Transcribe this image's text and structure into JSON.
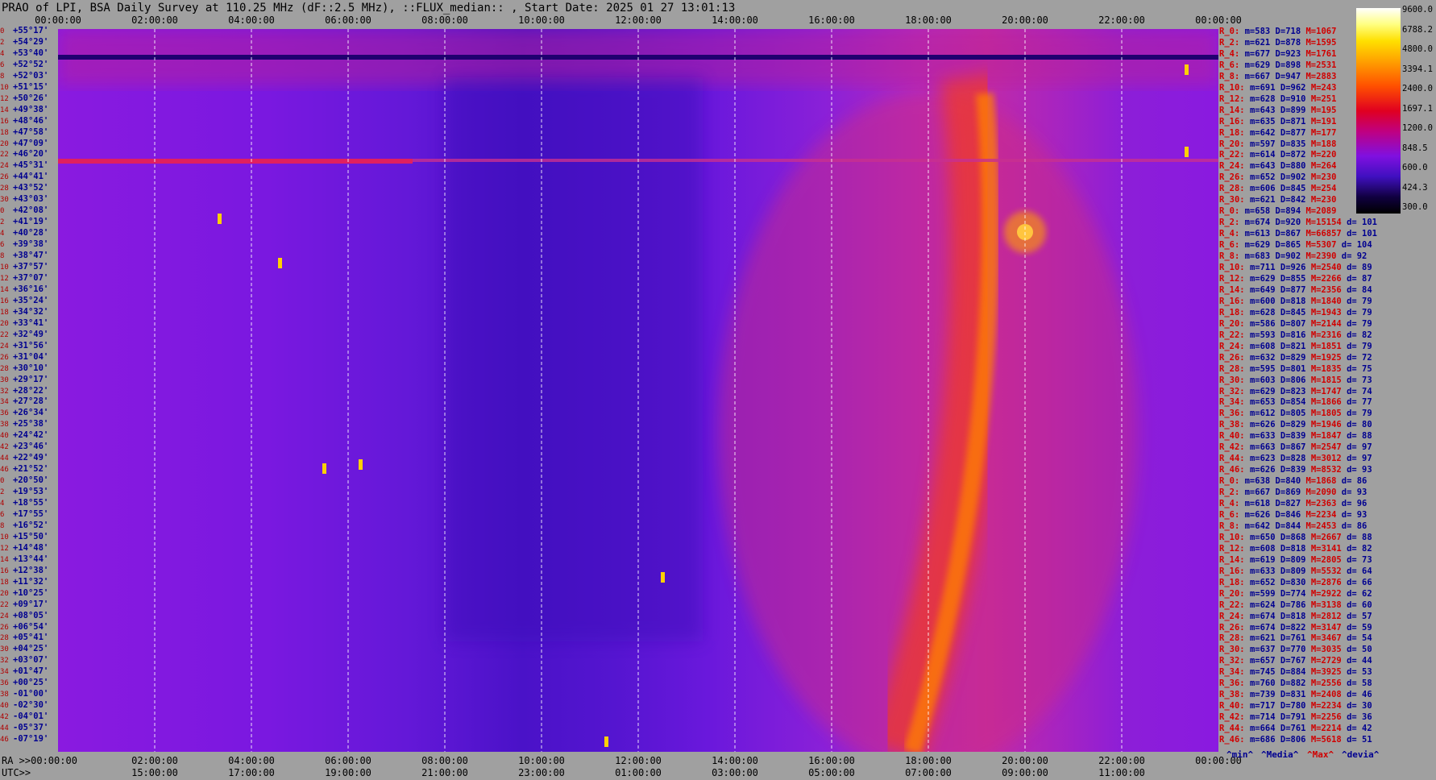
{
  "title": "PRAO of LPI, BSA Daily Survey at 110.25 MHz (dF::2.5 MHz), ::FLUX_median:: , Start Date: 2025 01 27 13:01:13",
  "chart_data": {
    "type": "heatmap",
    "title": "PRAO of LPI, BSA Daily Survey at 110.25 MHz (dF::2.5 MHz), ::FLUX_median:: , Start Date: 2025 01 27 13:01:13",
    "x_ra_ticks": [
      "00:00:00",
      "02:00:00",
      "04:00:00",
      "06:00:00",
      "08:00:00",
      "10:00:00",
      "12:00:00",
      "14:00:00",
      "16:00:00",
      "18:00:00",
      "20:00:00",
      "22:00:00",
      "00:00:00"
    ],
    "x_utc_ticks": [
      "15:00:00",
      "17:00:00",
      "19:00:00",
      "21:00:00",
      "23:00:00",
      "01:00:00",
      "03:00:00",
      "05:00:00",
      "07:00:00",
      "09:00:00",
      "11:00:00"
    ],
    "x_ra_prefix": "RA >>00:00:00",
    "x_utc_prefix": "UTC>>",
    "y_declinations": [
      "+55°17'",
      "+54°29'",
      "+53°40'",
      "+52°52'",
      "+52°03'",
      "+51°15'",
      "+50°26'",
      "+49°38'",
      "+48°46'",
      "+47°58'",
      "+47°09'",
      "+46°20'",
      "+45°31'",
      "+44°41'",
      "+43°52'",
      "+43°03'",
      "+42°08'",
      "+41°19'",
      "+40°28'",
      "+39°38'",
      "+38°47'",
      "+37°57'",
      "+37°07'",
      "+36°16'",
      "+35°24'",
      "+34°32'",
      "+33°41'",
      "+32°49'",
      "+31°56'",
      "+31°04'",
      "+30°10'",
      "+29°17'",
      "+28°22'",
      "+27°28'",
      "+26°34'",
      "+25°38'",
      "+24°42'",
      "+23°46'",
      "+22°49'",
      "+21°52'",
      "+20°50'",
      "+19°53'",
      "+18°55'",
      "+17°55'",
      "+16°52'",
      "+15°50'",
      "+14°48'",
      "+13°44'",
      "+12°38'",
      "+11°32'",
      "+10°25'",
      "+09°17'",
      "+08°05'",
      "+06°54'",
      "+05°41'",
      "+04°25'",
      "+03°07'",
      "+01°47'",
      "+00°25'",
      "-01°00'",
      "-02°30'",
      "-04°01'",
      "-05°37'",
      "-07°19'"
    ],
    "y_indices": [
      "0",
      "2",
      "4",
      "6",
      "8",
      "10",
      "12",
      "14",
      "16",
      "18",
      "20",
      "22",
      "24",
      "26",
      "28",
      "30",
      "0",
      "2",
      "4",
      "6",
      "8",
      "10",
      "12",
      "14",
      "16",
      "18",
      "20",
      "22",
      "24",
      "26",
      "28",
      "30",
      "32",
      "34",
      "36",
      "38",
      "40",
      "42",
      "44",
      "46",
      "0",
      "2",
      "4",
      "6",
      "8",
      "10",
      "12",
      "14",
      "16",
      "18",
      "20",
      "22",
      "24",
      "26",
      "28",
      "30",
      "32",
      "34",
      "36",
      "38",
      "40",
      "42",
      "44",
      "46"
    ],
    "colorbar_ticks": [
      "9600.0",
      "6788.2",
      "4800.0",
      "3394.1",
      "2400.0",
      "1697.1",
      "1200.0",
      "848.5",
      "600.0",
      "424.3",
      "300.0"
    ],
    "stats_legend": [
      "^min^",
      "^Media^",
      "^Max^",
      "^devia^"
    ],
    "stats": [
      {
        "r": "R_0:",
        "m": "m=583",
        "d": "D=718",
        "M": "M=1067",
        "dev": ""
      },
      {
        "r": "R_2:",
        "m": "m=621",
        "d": "D=878",
        "M": "M=1595",
        "dev": ""
      },
      {
        "r": "R_4:",
        "m": "m=677",
        "d": "D=923",
        "M": "M=1761",
        "dev": ""
      },
      {
        "r": "R_6:",
        "m": "m=629",
        "d": "D=898",
        "M": "M=2531",
        "dev": ""
      },
      {
        "r": "R_8:",
        "m": "m=667",
        "d": "D=947",
        "M": "M=2883",
        "dev": ""
      },
      {
        "r": "R_10:",
        "m": "m=691",
        "d": "D=962",
        "M": "M=243",
        "dev": ""
      },
      {
        "r": "R_12:",
        "m": "m=628",
        "d": "D=910",
        "M": "M=251",
        "dev": ""
      },
      {
        "r": "R_14:",
        "m": "m=643",
        "d": "D=899",
        "M": "M=195",
        "dev": ""
      },
      {
        "r": "R_16:",
        "m": "m=635",
        "d": "D=871",
        "M": "M=191",
        "dev": ""
      },
      {
        "r": "R_18:",
        "m": "m=642",
        "d": "D=877",
        "M": "M=177",
        "dev": ""
      },
      {
        "r": "R_20:",
        "m": "m=597",
        "d": "D=835",
        "M": "M=188",
        "dev": ""
      },
      {
        "r": "R_22:",
        "m": "m=614",
        "d": "D=872",
        "M": "M=220",
        "dev": ""
      },
      {
        "r": "R_24:",
        "m": "m=643",
        "d": "D=880",
        "M": "M=264",
        "dev": ""
      },
      {
        "r": "R_26:",
        "m": "m=652",
        "d": "D=902",
        "M": "M=230",
        "dev": ""
      },
      {
        "r": "R_28:",
        "m": "m=606",
        "d": "D=845",
        "M": "M=254",
        "dev": ""
      },
      {
        "r": "R_30:",
        "m": "m=621",
        "d": "D=842",
        "M": "M=230",
        "dev": ""
      },
      {
        "r": "R_0:",
        "m": "m=658",
        "d": "D=894",
        "M": "M=2089",
        "dev": ""
      },
      {
        "r": "R_2:",
        "m": "m=674",
        "d": "D=920",
        "M": "M=15154",
        "dev": "d= 101"
      },
      {
        "r": "R_4:",
        "m": "m=613",
        "d": "D=867",
        "M": "M=66857",
        "dev": "d= 101"
      },
      {
        "r": "R_6:",
        "m": "m=629",
        "d": "D=865",
        "M": "M=5307",
        "dev": "d= 104"
      },
      {
        "r": "R_8:",
        "m": "m=683",
        "d": "D=902",
        "M": "M=2390",
        "dev": "d= 92"
      },
      {
        "r": "R_10:",
        "m": "m=711",
        "d": "D=926",
        "M": "M=2540",
        "dev": "d= 89"
      },
      {
        "r": "R_12:",
        "m": "m=629",
        "d": "D=855",
        "M": "M=2266",
        "dev": "d= 87"
      },
      {
        "r": "R_14:",
        "m": "m=649",
        "d": "D=877",
        "M": "M=2356",
        "dev": "d= 84"
      },
      {
        "r": "R_16:",
        "m": "m=600",
        "d": "D=818",
        "M": "M=1840",
        "dev": "d= 79"
      },
      {
        "r": "R_18:",
        "m": "m=628",
        "d": "D=845",
        "M": "M=1943",
        "dev": "d= 79"
      },
      {
        "r": "R_20:",
        "m": "m=586",
        "d": "D=807",
        "M": "M=2144",
        "dev": "d= 79"
      },
      {
        "r": "R_22:",
        "m": "m=593",
        "d": "D=816",
        "M": "M=2316",
        "dev": "d= 82"
      },
      {
        "r": "R_24:",
        "m": "m=608",
        "d": "D=821",
        "M": "M=1851",
        "dev": "d= 79"
      },
      {
        "r": "R_26:",
        "m": "m=632",
        "d": "D=829",
        "M": "M=1925",
        "dev": "d= 72"
      },
      {
        "r": "R_28:",
        "m": "m=595",
        "d": "D=801",
        "M": "M=1835",
        "dev": "d= 75"
      },
      {
        "r": "R_30:",
        "m": "m=603",
        "d": "D=806",
        "M": "M=1815",
        "dev": "d= 73"
      },
      {
        "r": "R_32:",
        "m": "m=629",
        "d": "D=823",
        "M": "M=1747",
        "dev": "d= 74"
      },
      {
        "r": "R_34:",
        "m": "m=653",
        "d": "D=854",
        "M": "M=1866",
        "dev": "d= 77"
      },
      {
        "r": "R_36:",
        "m": "m=612",
        "d": "D=805",
        "M": "M=1805",
        "dev": "d= 79"
      },
      {
        "r": "R_38:",
        "m": "m=626",
        "d": "D=829",
        "M": "M=1946",
        "dev": "d= 80"
      },
      {
        "r": "R_40:",
        "m": "m=633",
        "d": "D=839",
        "M": "M=1847",
        "dev": "d= 88"
      },
      {
        "r": "R_42:",
        "m": "m=663",
        "d": "D=867",
        "M": "M=2547",
        "dev": "d= 97"
      },
      {
        "r": "R_44:",
        "m": "m=623",
        "d": "D=828",
        "M": "M=3012",
        "dev": "d= 97"
      },
      {
        "r": "R_46:",
        "m": "m=626",
        "d": "D=839",
        "M": "M=8532",
        "dev": "d= 93"
      },
      {
        "r": "R_0:",
        "m": "m=638",
        "d": "D=840",
        "M": "M=1868",
        "dev": "d= 86"
      },
      {
        "r": "R_2:",
        "m": "m=667",
        "d": "D=869",
        "M": "M=2090",
        "dev": "d= 93"
      },
      {
        "r": "R_4:",
        "m": "m=618",
        "d": "D=827",
        "M": "M=2363",
        "dev": "d= 96"
      },
      {
        "r": "R_6:",
        "m": "m=626",
        "d": "D=846",
        "M": "M=2234",
        "dev": "d= 93"
      },
      {
        "r": "R_8:",
        "m": "m=642",
        "d": "D=844",
        "M": "M=2453",
        "dev": "d= 86"
      },
      {
        "r": "R_10:",
        "m": "m=650",
        "d": "D=868",
        "M": "M=2667",
        "dev": "d= 88"
      },
      {
        "r": "R_12:",
        "m": "m=608",
        "d": "D=818",
        "M": "M=3141",
        "dev": "d= 82"
      },
      {
        "r": "R_14:",
        "m": "m=619",
        "d": "D=809",
        "M": "M=2805",
        "dev": "d= 73"
      },
      {
        "r": "R_16:",
        "m": "m=633",
        "d": "D=809",
        "M": "M=5532",
        "dev": "d= 64"
      },
      {
        "r": "R_18:",
        "m": "m=652",
        "d": "D=830",
        "M": "M=2876",
        "dev": "d= 66"
      },
      {
        "r": "R_20:",
        "m": "m=599",
        "d": "D=774",
        "M": "M=2922",
        "dev": "d= 62"
      },
      {
        "r": "R_22:",
        "m": "m=624",
        "d": "D=786",
        "M": "M=3138",
        "dev": "d= 60"
      },
      {
        "r": "R_24:",
        "m": "m=674",
        "d": "D=818",
        "M": "M=2812",
        "dev": "d= 57"
      },
      {
        "r": "R_26:",
        "m": "m=674",
        "d": "D=822",
        "M": "M=3147",
        "dev": "d= 59"
      },
      {
        "r": "R_28:",
        "m": "m=621",
        "d": "D=761",
        "M": "M=3467",
        "dev": "d= 54"
      },
      {
        "r": "R_30:",
        "m": "m=637",
        "d": "D=770",
        "M": "M=3035",
        "dev": "d= 50"
      },
      {
        "r": "R_32:",
        "m": "m=657",
        "d": "D=767",
        "M": "M=2729",
        "dev": "d= 44"
      },
      {
        "r": "R_34:",
        "m": "m=745",
        "d": "D=884",
        "M": "M=3925",
        "dev": "d= 53"
      },
      {
        "r": "R_36:",
        "m": "m=760",
        "d": "D=882",
        "M": "M=2556",
        "dev": "d= 58"
      },
      {
        "r": "R_38:",
        "m": "m=739",
        "d": "D=831",
        "M": "M=2408",
        "dev": "d= 46"
      },
      {
        "r": "R_40:",
        "m": "m=717",
        "d": "D=780",
        "M": "M=2234",
        "dev": "d= 30"
      },
      {
        "r": "R_42:",
        "m": "m=714",
        "d": "D=791",
        "M": "M=2256",
        "dev": "d= 36"
      },
      {
        "r": "R_44:",
        "m": "m=664",
        "d": "D=761",
        "M": "M=2214",
        "dev": "d= 42"
      },
      {
        "r": "R_46:",
        "m": "m=686",
        "d": "D=806",
        "M": "M=5618",
        "dev": "d= 51"
      }
    ]
  }
}
